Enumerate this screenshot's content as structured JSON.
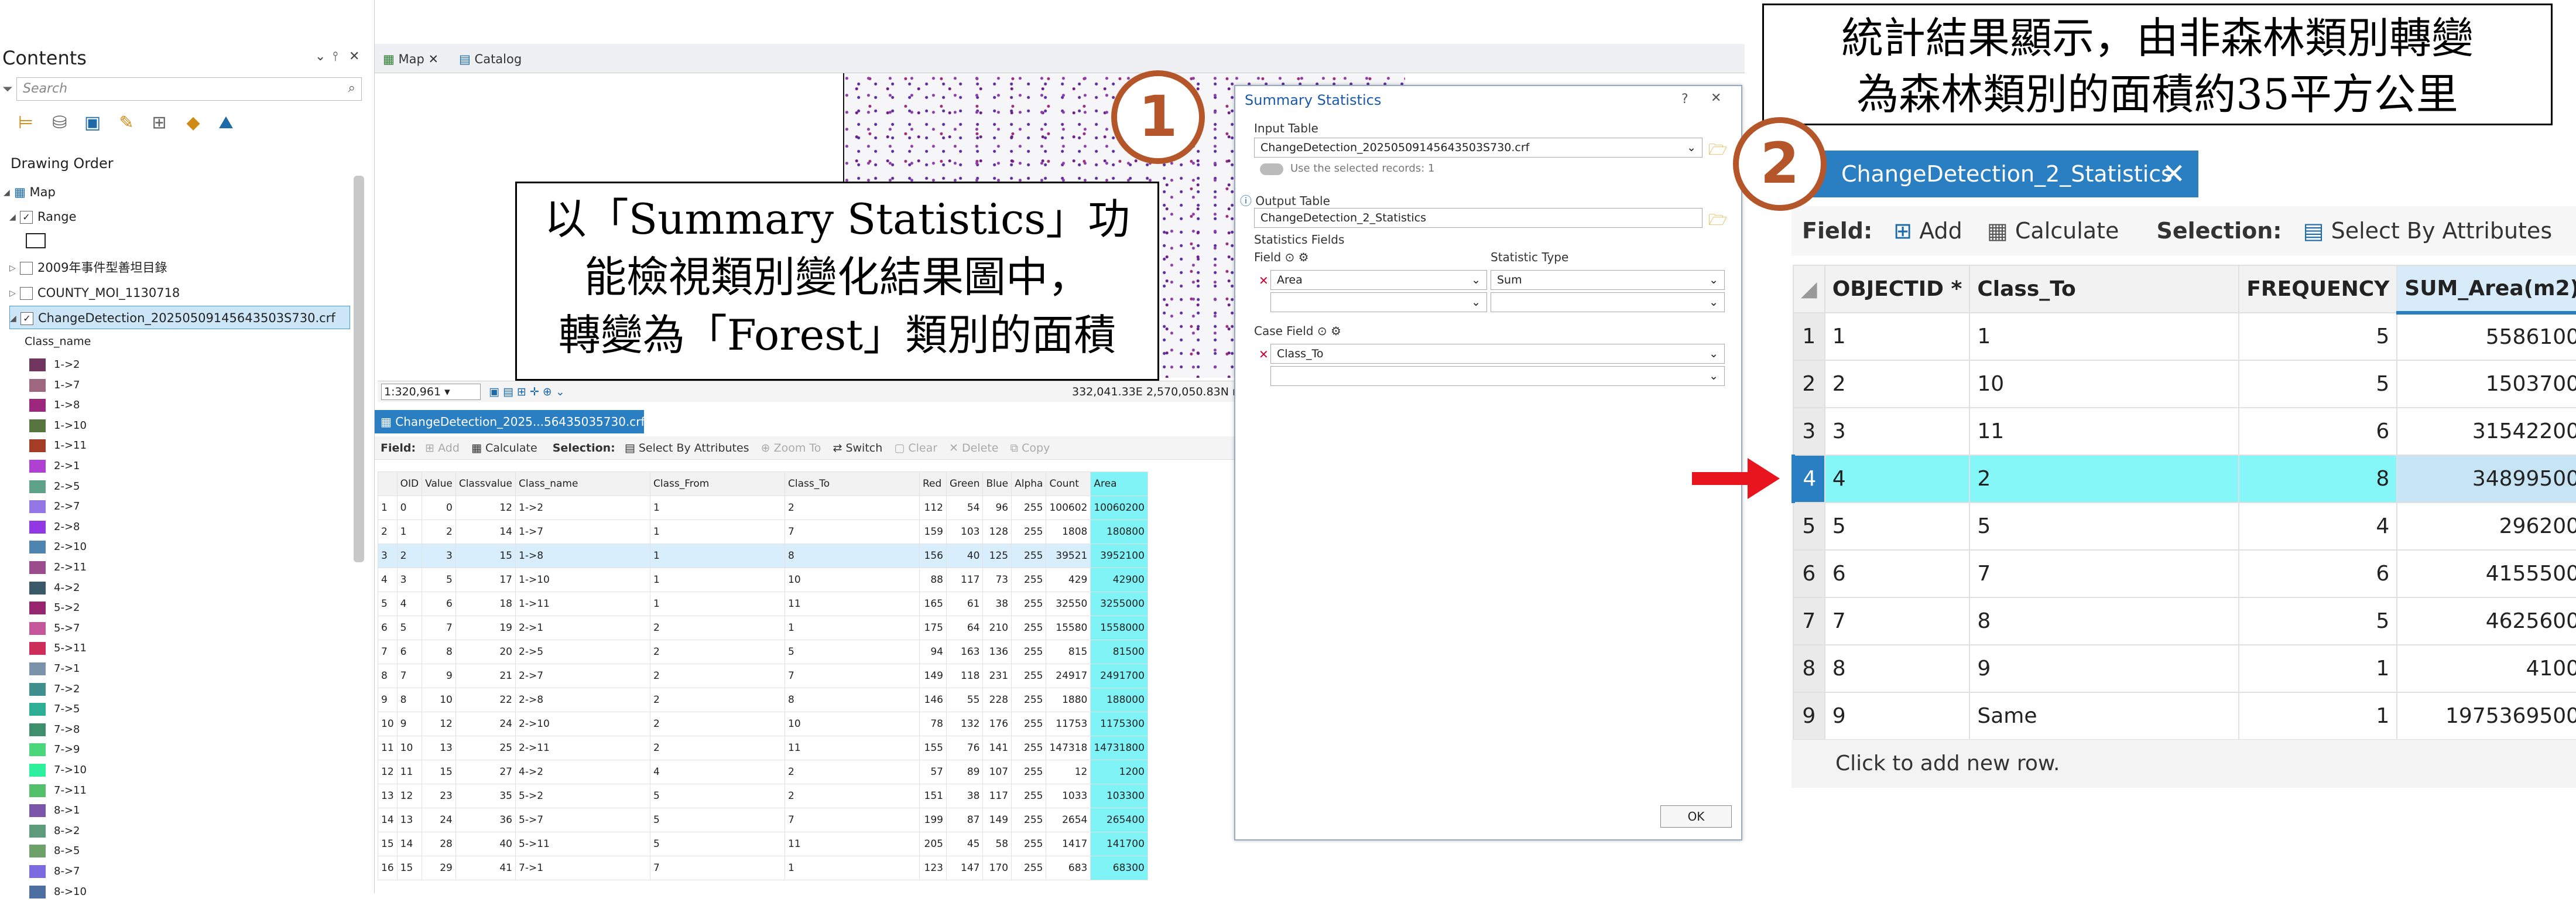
{
  "contents": {
    "title": "Contents",
    "search_placeholder": "Search",
    "drawing_order": "Drawing Order",
    "layers": [
      {
        "name": "Map"
      },
      {
        "name": "Range"
      },
      {
        "name": "2009年事件型善坦目錄"
      },
      {
        "name": "COUNTY_MOI_1130718"
      },
      {
        "name": "ChangeDetection_20250509145643503S730.crf"
      }
    ],
    "class_header": "Class_name",
    "legend": [
      {
        "label": "1->2",
        "color": "#70365f"
      },
      {
        "label": "1->7",
        "color": "#9f677f"
      },
      {
        "label": "1->8",
        "color": "#9c287d"
      },
      {
        "label": "1->10",
        "color": "#58753f"
      },
      {
        "label": "1->11",
        "color": "#a53d26"
      },
      {
        "label": "2->1",
        "color": "#af40d2"
      },
      {
        "label": "2->5",
        "color": "#5ea388"
      },
      {
        "label": "2->7",
        "color": "#9576e7"
      },
      {
        "label": "2->8",
        "color": "#9237e4"
      },
      {
        "label": "2->10",
        "color": "#4e84b0"
      },
      {
        "label": "2->11",
        "color": "#9b4c8d"
      },
      {
        "label": "4->2",
        "color": "#39596b"
      },
      {
        "label": "5->2",
        "color": "#97266e"
      },
      {
        "label": "5->7",
        "color": "#c7579b"
      },
      {
        "label": "5->11",
        "color": "#cd2d59"
      },
      {
        "label": "7->1",
        "color": "#7b93aa"
      },
      {
        "label": "7->2",
        "color": "#3f8f8f"
      },
      {
        "label": "7->5",
        "color": "#2fae96"
      },
      {
        "label": "7->8",
        "color": "#3e8f6e"
      },
      {
        "label": "7->9",
        "color": "#4ad67a"
      },
      {
        "label": "7->10",
        "color": "#2ef09c"
      },
      {
        "label": "7->11",
        "color": "#54c06b"
      },
      {
        "label": "8->1",
        "color": "#7b55a9"
      },
      {
        "label": "8->2",
        "color": "#5e9a7c"
      },
      {
        "label": "8->5",
        "color": "#6ea06a"
      },
      {
        "label": "8->7",
        "color": "#7c6be0"
      },
      {
        "label": "8->10",
        "color": "#4d6ea0"
      }
    ]
  },
  "map": {
    "tab_map": "Map",
    "tab_catalog": "Catalog",
    "scale": "1:320,961",
    "coords": "332,041.33E 2,570,050.83N m"
  },
  "attr_table": {
    "tab_label": "ChangeDetection_2025...56435035730.crf",
    "toolbar": {
      "field": "Field:",
      "add": "Add",
      "calculate": "Calculate",
      "selection": "Selection:",
      "select_by_attr": "Select By Attributes",
      "zoom_to": "Zoom To",
      "switch": "Switch",
      "clear": "Clear",
      "delete": "Delete",
      "copy": "Copy"
    },
    "columns": [
      "OID",
      "Value",
      "Classvalue",
      "Class_name",
      "Class_From",
      "Class_To",
      "Red",
      "Green",
      "Blue",
      "Alpha",
      "Count",
      "Area"
    ],
    "rows": [
      [
        "0",
        "0",
        "12",
        "1->2",
        "1",
        "2",
        "112",
        "54",
        "96",
        "255",
        "100602",
        "10060200"
      ],
      [
        "1",
        "2",
        "14",
        "1->7",
        "1",
        "7",
        "159",
        "103",
        "128",
        "255",
        "1808",
        "180800"
      ],
      [
        "2",
        "3",
        "15",
        "1->8",
        "1",
        "8",
        "156",
        "40",
        "125",
        "255",
        "39521",
        "3952100"
      ],
      [
        "3",
        "5",
        "17",
        "1->10",
        "1",
        "10",
        "88",
        "117",
        "73",
        "255",
        "429",
        "42900"
      ],
      [
        "4",
        "6",
        "18",
        "1->11",
        "1",
        "11",
        "165",
        "61",
        "38",
        "255",
        "32550",
        "3255000"
      ],
      [
        "5",
        "7",
        "19",
        "2->1",
        "2",
        "1",
        "175",
        "64",
        "210",
        "255",
        "15580",
        "1558000"
      ],
      [
        "6",
        "8",
        "20",
        "2->5",
        "2",
        "5",
        "94",
        "163",
        "136",
        "255",
        "815",
        "81500"
      ],
      [
        "7",
        "9",
        "21",
        "2->7",
        "2",
        "7",
        "149",
        "118",
        "231",
        "255",
        "24917",
        "2491700"
      ],
      [
        "8",
        "10",
        "22",
        "2->8",
        "2",
        "8",
        "146",
        "55",
        "228",
        "255",
        "1880",
        "188000"
      ],
      [
        "9",
        "12",
        "24",
        "2->10",
        "2",
        "10",
        "78",
        "132",
        "176",
        "255",
        "11753",
        "1175300"
      ],
      [
        "10",
        "13",
        "25",
        "2->11",
        "2",
        "11",
        "155",
        "76",
        "141",
        "255",
        "147318",
        "14731800"
      ],
      [
        "11",
        "15",
        "27",
        "4->2",
        "4",
        "2",
        "57",
        "89",
        "107",
        "255",
        "12",
        "1200"
      ],
      [
        "12",
        "23",
        "35",
        "5->2",
        "5",
        "2",
        "151",
        "38",
        "117",
        "255",
        "1033",
        "103300"
      ],
      [
        "13",
        "24",
        "36",
        "5->7",
        "5",
        "7",
        "199",
        "87",
        "149",
        "255",
        "2654",
        "265400"
      ],
      [
        "14",
        "28",
        "40",
        "5->11",
        "5",
        "11",
        "205",
        "45",
        "58",
        "255",
        "1417",
        "141700"
      ],
      [
        "15",
        "29",
        "41",
        "7->1",
        "7",
        "1",
        "123",
        "147",
        "170",
        "255",
        "683",
        "68300"
      ]
    ]
  },
  "dialog": {
    "title": "Summary Statistics",
    "help": "?",
    "input_table_label": "Input Table",
    "input_table_value": "ChangeDetection_20250509145643503S730.crf",
    "use_selected": "Use the selected records: 1",
    "output_table_label": "Output Table",
    "output_table_value": "ChangeDetection_2_Statistics",
    "stat_fields_label": "Statistics Fields",
    "field_label": "Field",
    "stat_type_label": "Statistic Type",
    "field_value": "Area",
    "stat_value": "Sum",
    "case_field_label": "Case Field",
    "case_field_value": "Class_To",
    "ok": "OK"
  },
  "callout1": {
    "line1": "以「Summary Statistics」功",
    "line2": "能檢視類別變化結果圖中，",
    "line3": "轉變為「Forest」類別的面積"
  },
  "callout2": {
    "line1": "統計結果顯示，由非森林類別轉變",
    "line2": "為森林類別的面積約35平方公里"
  },
  "step1": "1",
  "step2": "2",
  "stats_table": {
    "tab_label": "ChangeDetection_2_Statistics",
    "toolbar": {
      "field": "Field:",
      "add": "Add",
      "calculate": "Calculate",
      "selection": "Selection:",
      "select_by_attr": "Select By Attributes"
    },
    "columns": [
      "OBJECTID *",
      "Class_To",
      "FREQUENCY",
      "SUM_Area(m2)"
    ],
    "rows": [
      [
        "1",
        "1",
        "1",
        "5",
        "5586100"
      ],
      [
        "2",
        "2",
        "10",
        "5",
        "1503700"
      ],
      [
        "3",
        "3",
        "11",
        "6",
        "31542200"
      ],
      [
        "4",
        "4",
        "2",
        "8",
        "34899500"
      ],
      [
        "5",
        "5",
        "5",
        "4",
        "296200"
      ],
      [
        "6",
        "6",
        "7",
        "6",
        "4155500"
      ],
      [
        "7",
        "7",
        "8",
        "5",
        "4625600"
      ],
      [
        "8",
        "8",
        "9",
        "1",
        "4100"
      ],
      [
        "9",
        "9",
        "Same",
        "1",
        "1975369500"
      ]
    ],
    "selected_row": 3,
    "add_row": "Click to add new row."
  },
  "colors": {
    "accent": "#2a7ec2",
    "highlight": "#7ff3f5",
    "step_circle": "#b5562a",
    "arrow": "#e8141e"
  }
}
